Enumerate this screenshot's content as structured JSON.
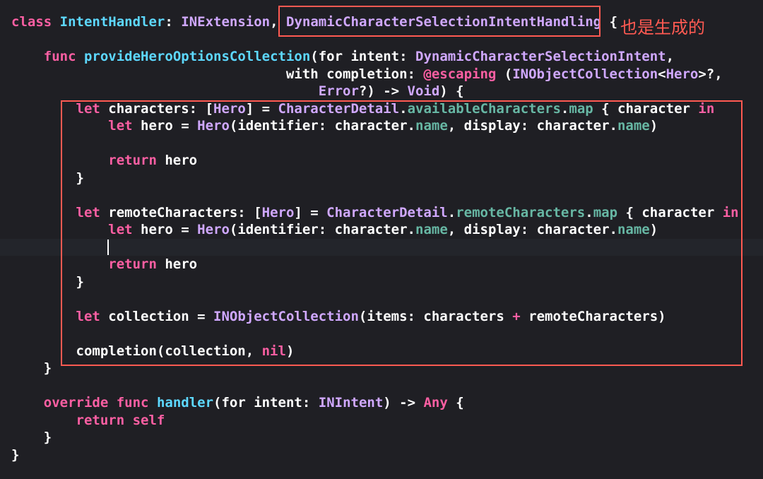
{
  "colors": {
    "background": "#1f1f24",
    "current_line": "#23252b",
    "keyword": "#fc5fa3",
    "type_decl": "#5dd8ff",
    "type_ref": "#d0a8ff",
    "member": "#67b7a4",
    "plain": "#ffffff",
    "highlight_box": "#ff5a52"
  },
  "annotation": "也是生成的",
  "code_lines": [
    [
      [
        "kw",
        "class"
      ],
      [
        "pl",
        " "
      ],
      [
        "tp",
        "IntentHandler"
      ],
      [
        "pl",
        ": "
      ],
      [
        "cl",
        "INExtension"
      ],
      [
        "pl",
        ", "
      ],
      [
        "cl",
        "DynamicCharacterSelectionIntentHandling"
      ],
      [
        "pl",
        " {"
      ]
    ],
    [],
    [
      [
        "pl",
        "    "
      ],
      [
        "kw",
        "func"
      ],
      [
        "pl",
        " "
      ],
      [
        "tp",
        "provideHeroOptionsCollection"
      ],
      [
        "pl",
        "(for intent: "
      ],
      [
        "cl",
        "DynamicCharacterSelectionIntent"
      ],
      [
        "pl",
        ","
      ]
    ],
    [
      [
        "pl",
        "                                  with completion: "
      ],
      [
        "kw",
        "@escaping"
      ],
      [
        "pl",
        " ("
      ],
      [
        "cl",
        "INObjectCollection"
      ],
      [
        "pl",
        "<"
      ],
      [
        "cl",
        "Hero"
      ],
      [
        "pl",
        ">?,"
      ]
    ],
    [
      [
        "pl",
        "                                      "
      ],
      [
        "cl",
        "Error"
      ],
      [
        "pl",
        "?) -> "
      ],
      [
        "cl",
        "Void"
      ],
      [
        "pl",
        ") {"
      ]
    ],
    [
      [
        "pl",
        "        "
      ],
      [
        "kw",
        "let"
      ],
      [
        "pl",
        " characters: ["
      ],
      [
        "cl",
        "Hero"
      ],
      [
        "pl",
        "] = "
      ],
      [
        "cl",
        "CharacterDetail"
      ],
      [
        "pl",
        "."
      ],
      [
        "cl2",
        "availableCharacters"
      ],
      [
        "pl",
        "."
      ],
      [
        "cl2",
        "map"
      ],
      [
        "pl",
        " { character "
      ],
      [
        "kw",
        "in"
      ]
    ],
    [
      [
        "pl",
        "            "
      ],
      [
        "kw",
        "let"
      ],
      [
        "pl",
        " hero = "
      ],
      [
        "cl",
        "Hero"
      ],
      [
        "pl",
        "(identifier: character."
      ],
      [
        "cl2",
        "name"
      ],
      [
        "pl",
        ", display: character."
      ],
      [
        "cl2",
        "name"
      ],
      [
        "pl",
        ")"
      ]
    ],
    [],
    [
      [
        "pl",
        "            "
      ],
      [
        "kw",
        "return"
      ],
      [
        "pl",
        " hero"
      ]
    ],
    [
      [
        "pl",
        "        }"
      ]
    ],
    [],
    [
      [
        "pl",
        "        "
      ],
      [
        "kw",
        "let"
      ],
      [
        "pl",
        " remoteCharacters: ["
      ],
      [
        "cl",
        "Hero"
      ],
      [
        "pl",
        "] = "
      ],
      [
        "cl",
        "CharacterDetail"
      ],
      [
        "pl",
        "."
      ],
      [
        "cl2",
        "remoteCharacters"
      ],
      [
        "pl",
        "."
      ],
      [
        "cl2",
        "map"
      ],
      [
        "pl",
        " { character "
      ],
      [
        "kw",
        "in"
      ]
    ],
    [
      [
        "pl",
        "            "
      ],
      [
        "kw",
        "let"
      ],
      [
        "pl",
        " hero = "
      ],
      [
        "cl",
        "Hero"
      ],
      [
        "pl",
        "(identifier: character."
      ],
      [
        "cl2",
        "name"
      ],
      [
        "pl",
        ", display: character."
      ],
      [
        "cl2",
        "name"
      ],
      [
        "pl",
        ")"
      ]
    ],
    [],
    [
      [
        "pl",
        "            "
      ],
      [
        "kw",
        "return"
      ],
      [
        "pl",
        " hero"
      ]
    ],
    [
      [
        "pl",
        "        }"
      ]
    ],
    [],
    [
      [
        "pl",
        "        "
      ],
      [
        "kw",
        "let"
      ],
      [
        "pl",
        " collection = "
      ],
      [
        "cl",
        "INObjectCollection"
      ],
      [
        "pl",
        "(items: characters "
      ],
      [
        "kw",
        "+"
      ],
      [
        "pl",
        " remoteCharacters)"
      ]
    ],
    [],
    [
      [
        "pl",
        "        completion(collection, "
      ],
      [
        "kw",
        "nil"
      ],
      [
        "pl",
        ")"
      ]
    ],
    [
      [
        "pl",
        "    }"
      ]
    ],
    [],
    [
      [
        "pl",
        "    "
      ],
      [
        "kw",
        "override"
      ],
      [
        "pl",
        " "
      ],
      [
        "kw",
        "func"
      ],
      [
        "pl",
        " "
      ],
      [
        "tp",
        "handler"
      ],
      [
        "pl",
        "(for intent: "
      ],
      [
        "cl",
        "INIntent"
      ],
      [
        "pl",
        ") -> "
      ],
      [
        "kw",
        "Any"
      ],
      [
        "pl",
        " {"
      ]
    ],
    [
      [
        "pl",
        "        "
      ],
      [
        "kw",
        "return"
      ],
      [
        "pl",
        " "
      ],
      [
        "kw",
        "self"
      ]
    ],
    [
      [
        "pl",
        "    }"
      ]
    ],
    [
      [
        "pl",
        "}"
      ]
    ]
  ]
}
